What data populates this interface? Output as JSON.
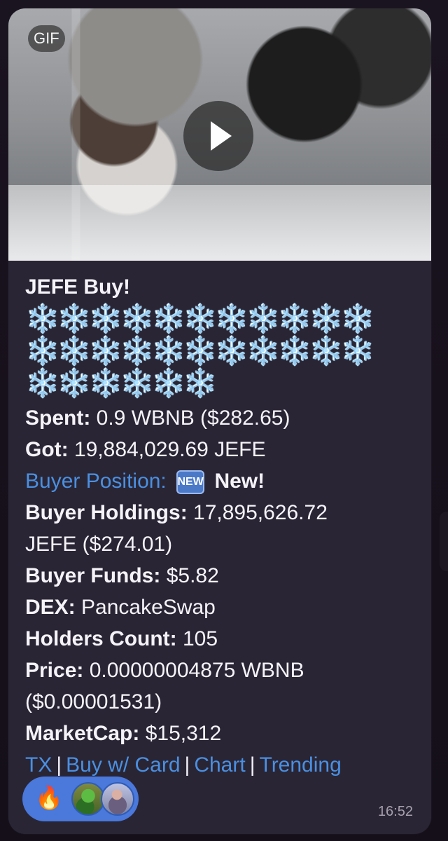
{
  "media": {
    "badge": "GIF"
  },
  "message": {
    "title": "JEFE Buy!",
    "snowflakes": [
      [
        "❄️",
        "❄️",
        "❄️",
        "❄️",
        "❄️",
        "❄️",
        "❄️",
        "❄️",
        "❄️",
        "❄️",
        "❄️"
      ],
      [
        "❄️",
        "❄️",
        "❄️",
        "❄️",
        "❄️",
        "❄️",
        "❄️",
        "❄️",
        "❄️",
        "❄️",
        "❄️"
      ],
      [
        "❄️",
        "❄️",
        "❄️",
        "❄️",
        "❄️",
        "❄️"
      ]
    ],
    "spent": {
      "label": "Spent:",
      "value": " 0.9 WBNB ($282.65)"
    },
    "got": {
      "label": "Got:",
      "value": " 19,884,029.69 JEFE"
    },
    "buyer_position": {
      "label": "Buyer Position:",
      "badge": "NEW",
      "value": " New!"
    },
    "buyer_holdings": {
      "label": "Buyer Holdings:",
      "value_line1": " 17,895,626.72",
      "value_line2": "JEFE ($274.01)"
    },
    "buyer_funds": {
      "label": "Buyer Funds:",
      "value": " $5.82"
    },
    "dex": {
      "label": "DEX:",
      "value": " PancakeSwap"
    },
    "holders_count": {
      "label": "Holders Count:",
      "value": " 105"
    },
    "price": {
      "label": "Price:",
      "value_line1": " 0.00000004875 WBNB",
      "value_line2": "($0.00001531)"
    },
    "market_cap": {
      "label": "MarketCap:",
      "value": " $15,312"
    },
    "links": {
      "tx": "TX",
      "buy_card": "Buy w/ Card",
      "chart": "Chart",
      "trending": "Trending",
      "separator": "|"
    }
  },
  "reaction": {
    "emoji": "🔥",
    "avatar_icons": [
      "avatar-green-character-icon",
      "avatar-person-icon"
    ]
  },
  "meta": {
    "time": "16:52"
  },
  "colors": {
    "bubble": "#2a2534",
    "link": "#4a90e2",
    "reaction": "#4a78db",
    "text": "#f5f3f8",
    "time": "#a6a0ae"
  }
}
